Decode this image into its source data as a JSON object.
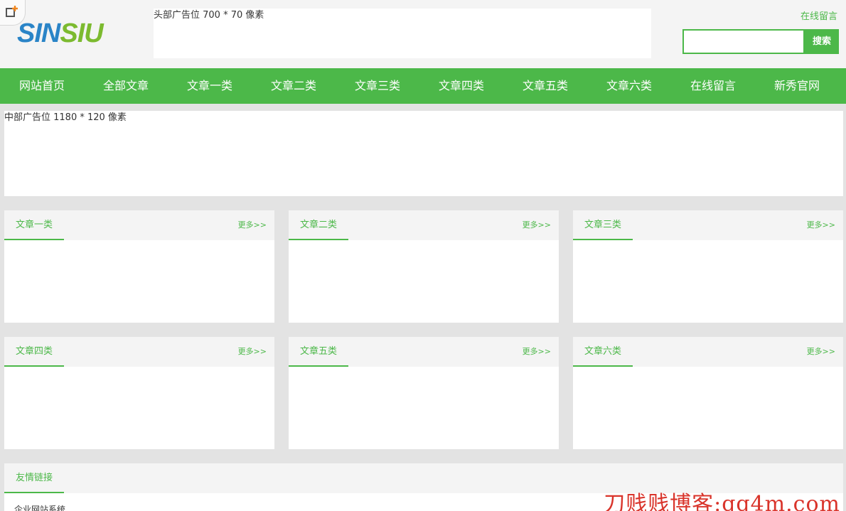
{
  "header": {
    "logo_part1": "SINSIU",
    "top_ad_text": "头部广告位 700 * 70 像素",
    "message_link": "在线留言",
    "search_placeholder": "",
    "search_button": "搜索"
  },
  "nav": {
    "items": [
      "网站首页",
      "全部文章",
      "文章一类",
      "文章二类",
      "文章三类",
      "文章四类",
      "文章五类",
      "文章六类",
      "在线留言",
      "新秀官网"
    ]
  },
  "middle_ad_text": "中部广告位 1180 * 120 像素",
  "sections": [
    {
      "title": "文章一类",
      "more": "更多>>"
    },
    {
      "title": "文章二类",
      "more": "更多>>"
    },
    {
      "title": "文章三类",
      "more": "更多>>"
    },
    {
      "title": "文章四类",
      "more": "更多>>"
    },
    {
      "title": "文章五类",
      "more": "更多>>"
    },
    {
      "title": "文章六类",
      "more": "更多>>"
    }
  ],
  "friend_links": {
    "title": "友情链接",
    "items": [
      "企业网站系统"
    ]
  },
  "watermark": "刀贱贱博客:qq4m.com",
  "colors": {
    "accent": "#4cb849",
    "logo_blue": "#2a84c7",
    "logo_green": "#7cba2f"
  }
}
